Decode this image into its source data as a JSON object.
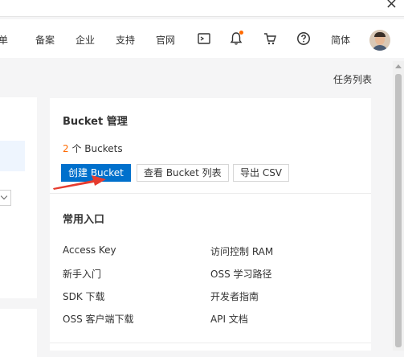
{
  "nav": {
    "items": [
      "工单",
      "备案",
      "企业",
      "支持",
      "官网",
      "简体"
    ],
    "item0_display": "工单"
  },
  "task_list": "任务列表",
  "bucket_card": {
    "title": "Bucket 管理",
    "count": "2",
    "count_suffix": "个 Buckets",
    "create_button": "创建 Bucket",
    "list_button": "查看 Bucket 列表",
    "export_button": "导出 CSV"
  },
  "common_entry": {
    "title": "常用入口",
    "links": [
      "Access Key",
      "访问控制 RAM",
      "新手入门",
      "OSS 学习路径",
      "SDK 下载",
      "开发者指南",
      "OSS 客户端下载",
      "API 文档"
    ]
  },
  "colors": {
    "accent": "#ff6a00",
    "primary": "#0070cc",
    "annotation_arrow": "#e63b2e"
  },
  "icons": [
    "terminal-icon",
    "bell-icon",
    "cart-icon",
    "help-icon",
    "close-icon"
  ]
}
